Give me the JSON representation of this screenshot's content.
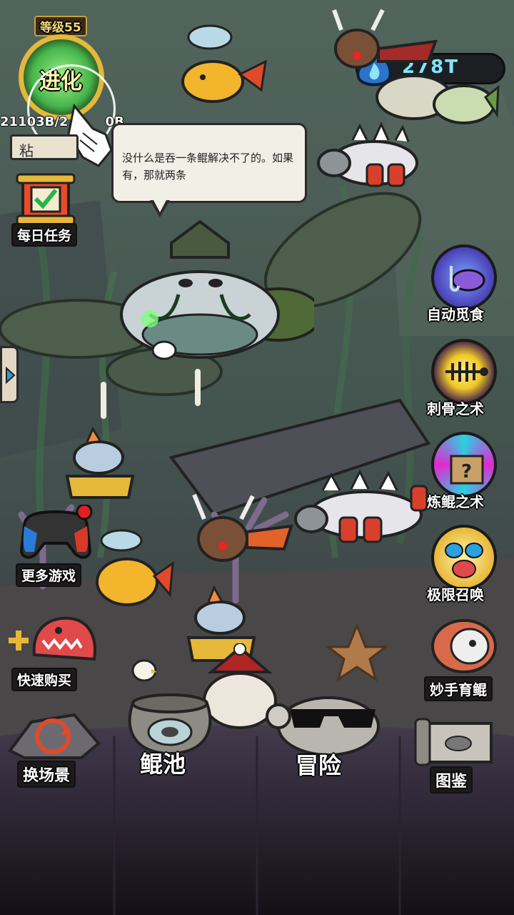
{
  "player": {
    "level_label": "等级55",
    "evolve_label": "进化",
    "progress_text": "21103B/2",
    "progress_suffix": "0B",
    "action_label": "粘"
  },
  "currency": {
    "amount": "278T",
    "icon": "blue-flame-icon"
  },
  "speech": {
    "text": "没什么是吞一条鲲解决不了的。如果有，那就两条"
  },
  "left_menu": {
    "daily_tasks": "每日任务",
    "more_games": "更多游戏",
    "quick_buy": "快速购买"
  },
  "right_menu": {
    "auto_feed": "自动觅食",
    "bone_art": "刺骨之术",
    "refine_art": "炼鲲之术",
    "extreme_summon": "极限召唤",
    "breed": "妙手育鲲"
  },
  "bottom_nav": {
    "switch_scene": "换场景",
    "kun_pool": "鲲池",
    "adventure": "冒险",
    "collection": "图鉴"
  },
  "colors": {
    "water": "#3d5350",
    "seabed": "#4a4b52",
    "bottom_bar": "#3a2f3d",
    "gold": "#e5b83a",
    "label_bg": "#1d1a1c"
  }
}
